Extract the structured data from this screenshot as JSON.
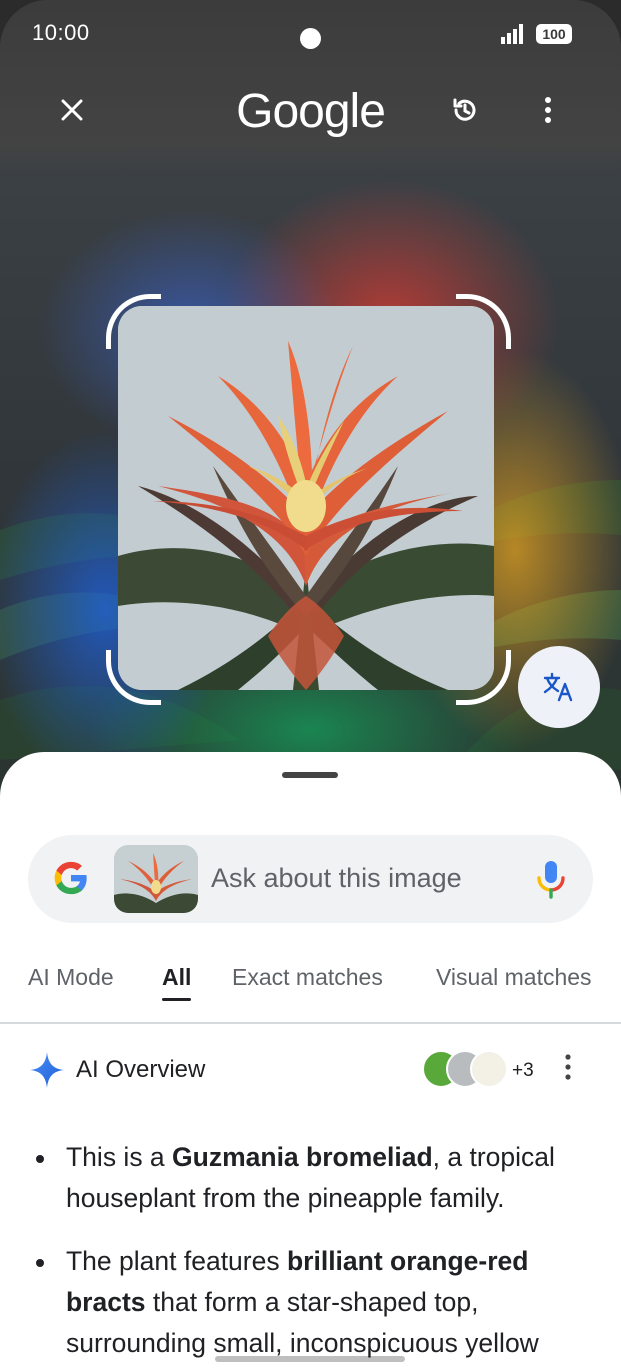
{
  "status_bar": {
    "time": "10:00",
    "battery": "100"
  },
  "header": {
    "logo": "Google"
  },
  "search": {
    "placeholder": "Ask about this image"
  },
  "tabs": [
    {
      "label": "AI Mode"
    },
    {
      "label": "All"
    },
    {
      "label": "Exact matches"
    },
    {
      "label": "Visual matches"
    }
  ],
  "active_tab": "All",
  "overview": {
    "title": "AI Overview",
    "sources_extra": "+3",
    "bullets": [
      {
        "pre": "This is a ",
        "bold": "Guzmania bromeliad",
        "post": ", a tropical houseplant from the pineapple family."
      },
      {
        "pre": "The plant features ",
        "bold": "brilliant orange-red bracts",
        "post": " that form a star-shaped top, surrounding small, inconspicuous yellow"
      }
    ]
  },
  "colors": {
    "google_blue": "#4285F4",
    "google_red": "#EA4335",
    "google_yellow": "#FBBC05",
    "google_green": "#34A853",
    "text_primary": "#202124",
    "text_secondary": "#5f6368"
  },
  "icons": {
    "close": "close-icon",
    "history": "history-icon",
    "more": "more-vert-icon",
    "translate": "translate-icon",
    "mic": "mic-icon",
    "sparkle": "ai-sparkle-icon"
  }
}
